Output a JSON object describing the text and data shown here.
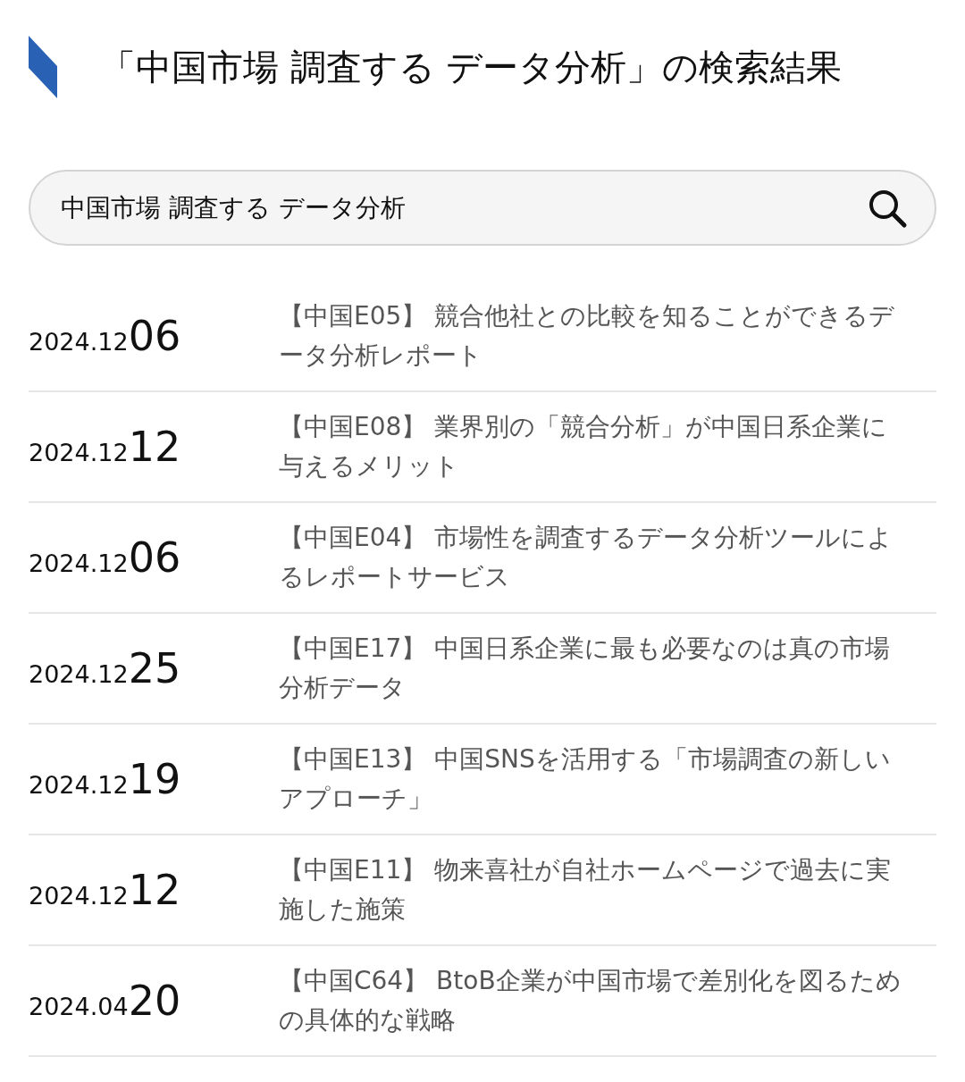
{
  "heading": "「中国市場 調査する データ分析」の検索結果",
  "search": {
    "value": "中国市場 調査する データ分析"
  },
  "results": [
    {
      "year_month": "2024.12",
      "day": "06",
      "title": "【中国E05】 競合他社との比較を知ることができるデータ分析レポート"
    },
    {
      "year_month": "2024.12",
      "day": "12",
      "title": "【中国E08】 業界別の「競合分析」が中国日系企業に与えるメリット"
    },
    {
      "year_month": "2024.12",
      "day": "06",
      "title": "【中国E04】 市場性を調査するデータ分析ツールによるレポートサービス"
    },
    {
      "year_month": "2024.12",
      "day": "25",
      "title": "【中国E17】 中国日系企業に最も必要なのは真の市場分析データ"
    },
    {
      "year_month": "2024.12",
      "day": "19",
      "title": "【中国E13】 中国SNSを活用する「市場調査の新しいアプローチ」"
    },
    {
      "year_month": "2024.12",
      "day": "12",
      "title": "【中国E11】 物来喜社が自社ホームページで過去に実施した施策"
    },
    {
      "year_month": "2024.04",
      "day": "20",
      "title": "【中国C64】 BtoB企業が中国市場で差別化を図るための具体的な戦略"
    }
  ]
}
